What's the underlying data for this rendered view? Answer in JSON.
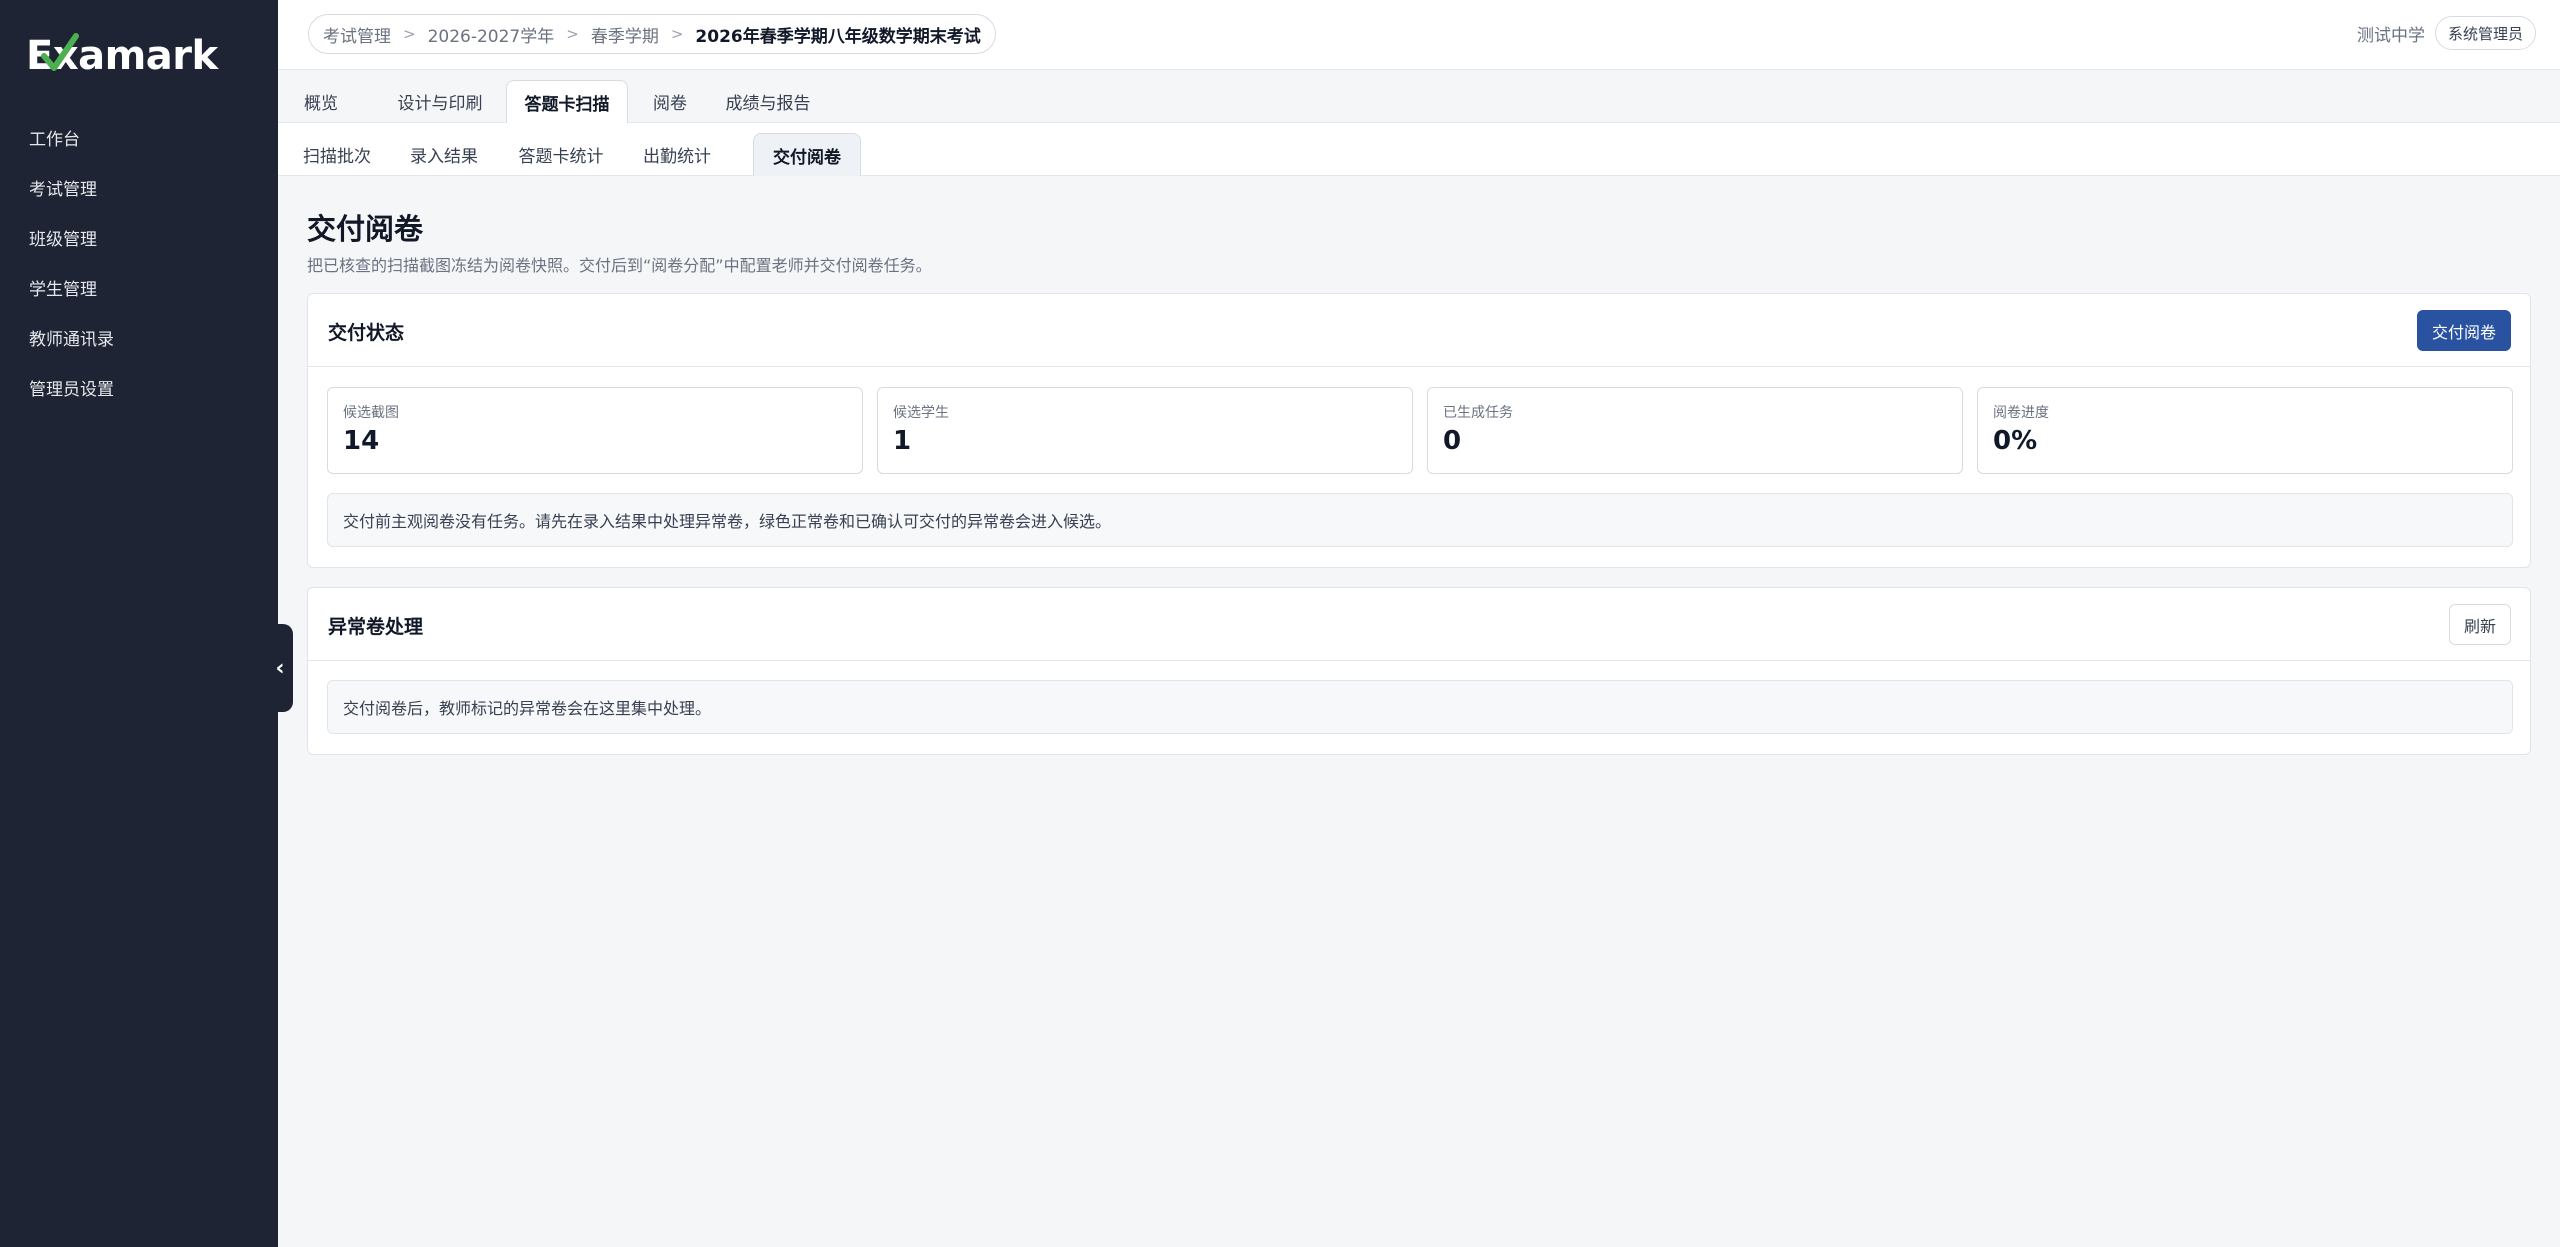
{
  "app": {
    "logo_text": "Examark",
    "brand_color": "#1e2433",
    "accent_check_color": "#4caf50",
    "primary_button_color": "#2953a0"
  },
  "sidebar": {
    "items": [
      {
        "label": "工作台"
      },
      {
        "label": "考试管理"
      },
      {
        "label": "班级管理"
      },
      {
        "label": "学生管理"
      },
      {
        "label": "教师通讯录"
      },
      {
        "label": "管理员设置"
      }
    ],
    "collapse_icon": "chevron-left-icon"
  },
  "header": {
    "breadcrumb": [
      "考试管理",
      "2026-2027学年",
      "春季学期",
      "2026年春季学期八年级数学期末考试"
    ],
    "separator": ">",
    "school": "测试中学",
    "role": "系统管理员"
  },
  "tabs_main": [
    {
      "label": "概览",
      "active": false
    },
    {
      "label": "设计与印刷",
      "active": false
    },
    {
      "label": "答题卡扫描",
      "active": true
    },
    {
      "label": "阅卷",
      "active": false
    },
    {
      "label": "成绩与报告",
      "active": false
    }
  ],
  "tabs_sub": [
    {
      "label": "扫描批次",
      "active": false
    },
    {
      "label": "录入结果",
      "active": false
    },
    {
      "label": "答题卡统计",
      "active": false
    },
    {
      "label": "出勤统计",
      "active": false
    },
    {
      "label": "交付阅卷",
      "active": true
    }
  ],
  "page": {
    "title": "交付阅卷",
    "description": "把已核查的扫描截图冻结为阅卷快照。交付后到“阅卷分配”中配置老师并交付阅卷任务。"
  },
  "delivery_card": {
    "title": "交付状态",
    "action_label": "交付阅卷",
    "stats": [
      {
        "label": "候选截图",
        "value": "14"
      },
      {
        "label": "候选学生",
        "value": "1"
      },
      {
        "label": "已生成任务",
        "value": "0"
      },
      {
        "label": "阅卷进度",
        "value": "0%"
      }
    ],
    "notice": "交付前主观阅卷没有任务。请先在录入结果中处理异常卷，绿色正常卷和已确认可交付的异常卷会进入候选。"
  },
  "exception_card": {
    "title": "异常卷处理",
    "action_label": "刷新",
    "notice": "交付阅卷后，教师标记的异常卷会在这里集中处理。"
  }
}
